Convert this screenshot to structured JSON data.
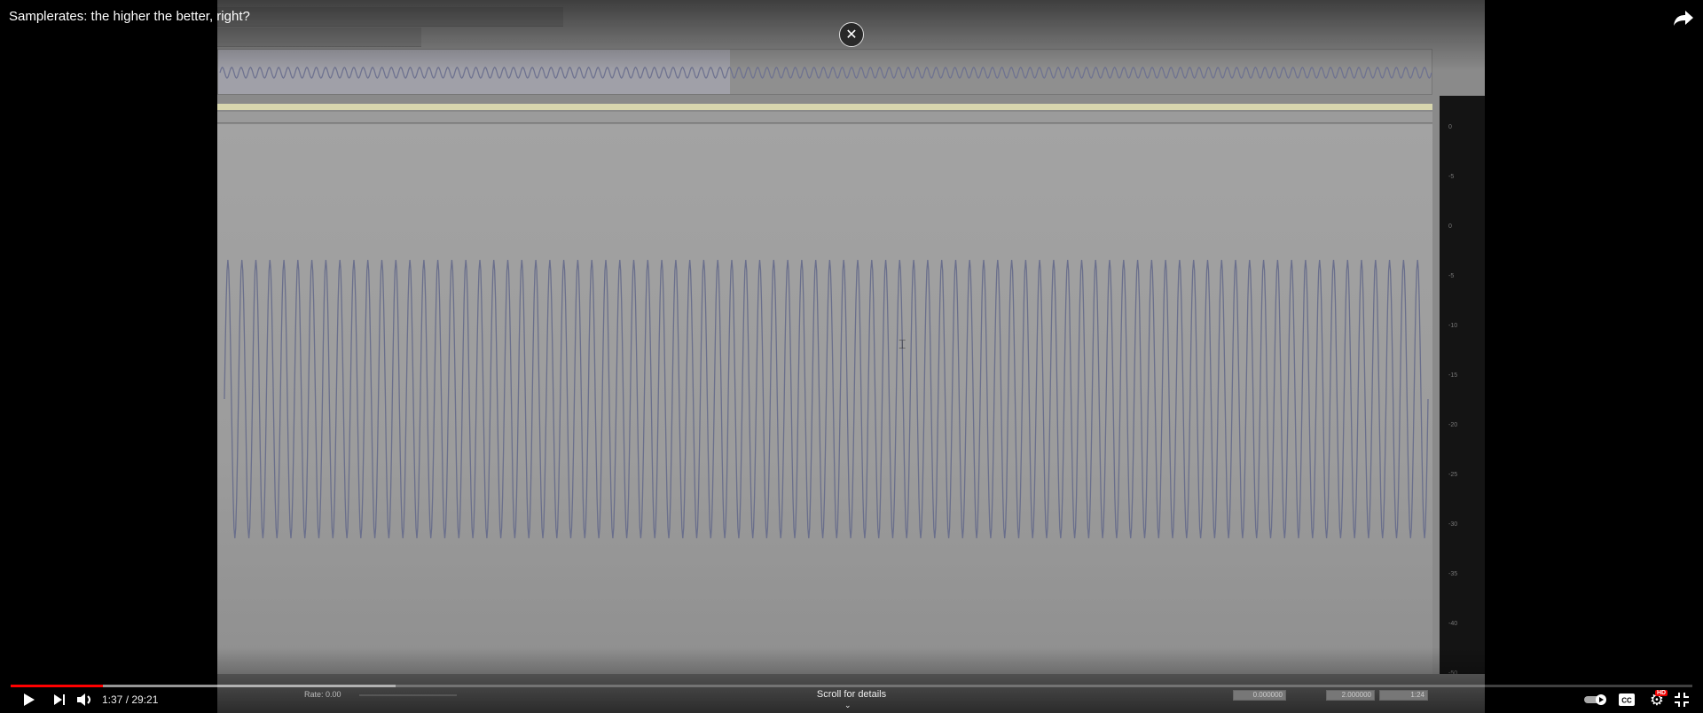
{
  "video": {
    "title": "Samplerates: the higher the better, right?",
    "current_time": "1:37",
    "duration": "29:21",
    "time_separator": " / ",
    "progress_fraction": 0.055,
    "buffered_fraction": 0.229,
    "scroll_hint": "Scroll for details",
    "hd_badge": "HD"
  },
  "editor": {
    "rate_label": "Rate: 0.00",
    "time_start": "0.000000",
    "time_end": "2.000000",
    "zoom_ratio": "1:24",
    "meter_labels": [
      "0",
      "-5",
      "0",
      "-5",
      "-10",
      "-15",
      "-20",
      "-25",
      "-30",
      "-35",
      "-40",
      "-50"
    ],
    "waveform_cycles": 86
  },
  "colors": {
    "progress": "#ff0000",
    "waveform": "#6a6f8c"
  }
}
